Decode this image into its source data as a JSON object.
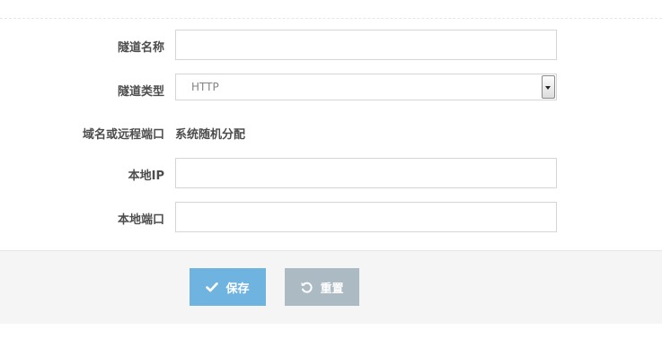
{
  "form": {
    "tunnel_name": {
      "label": "隧道名称",
      "value": ""
    },
    "tunnel_type": {
      "label": "隧道类型",
      "selected": "HTTP"
    },
    "domain_port": {
      "label": "域名或远程端口",
      "value": "系统随机分配"
    },
    "local_ip": {
      "label": "本地IP",
      "value": ""
    },
    "local_port": {
      "label": "本地端口",
      "value": ""
    }
  },
  "actions": {
    "save_label": "保存",
    "save_icon": "check-icon",
    "reset_label": "重置",
    "reset_icon": "undo-icon"
  },
  "colors": {
    "save_button": "#6fb3e0",
    "reset_button": "#abbac3",
    "action_bar": "#f5f5f5"
  }
}
